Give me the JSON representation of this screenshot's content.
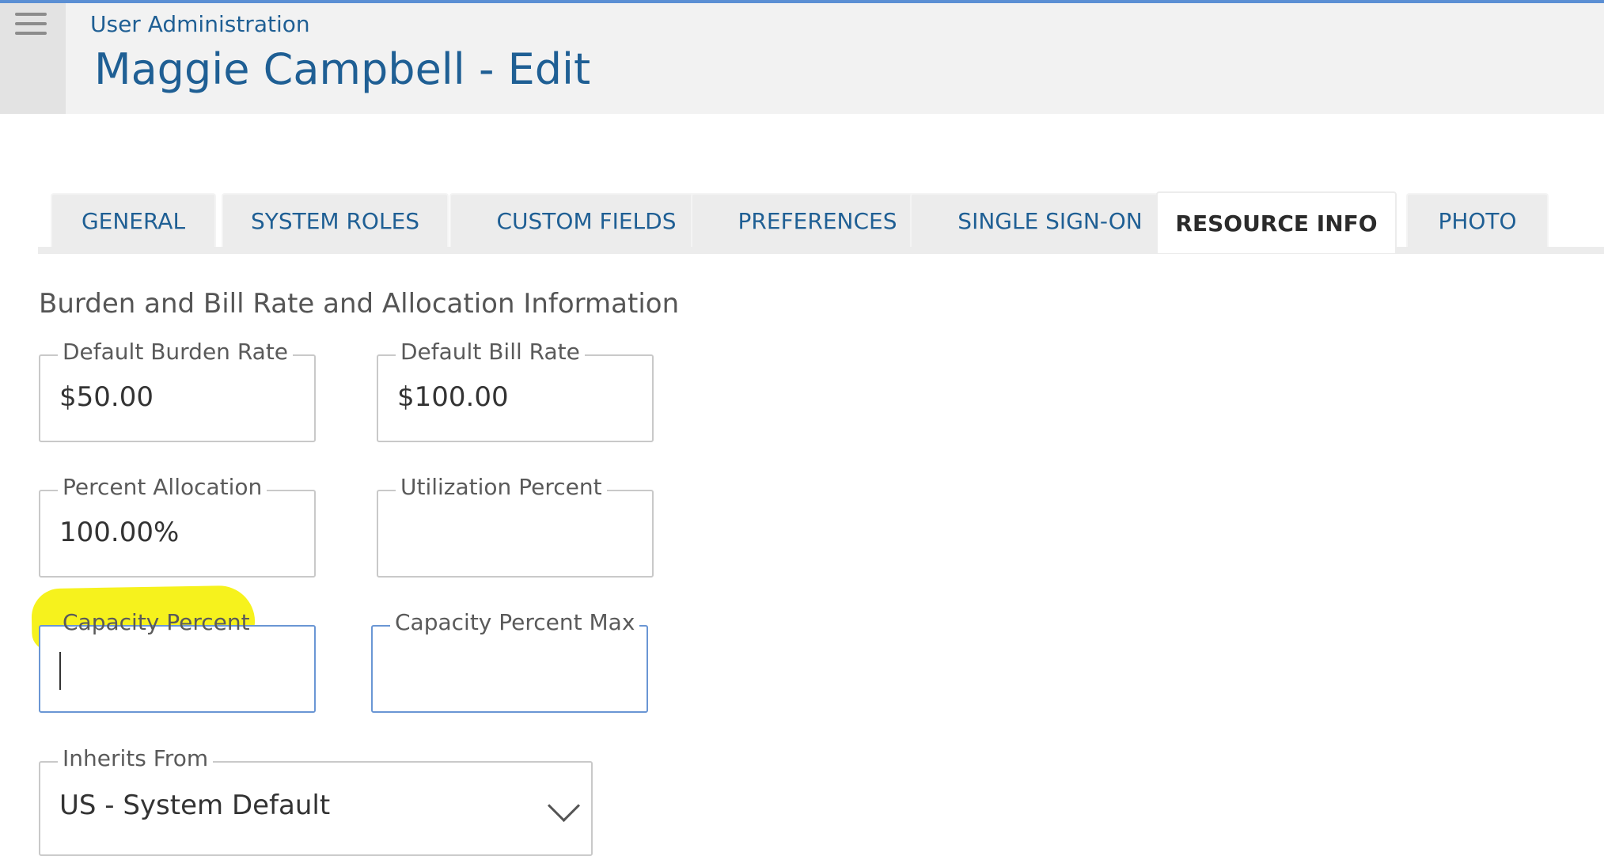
{
  "header": {
    "breadcrumb": "User Administration",
    "title": "Maggie Campbell - Edit",
    "menu_icon": "hamburger-menu-icon"
  },
  "tabs": [
    {
      "label": "GENERAL",
      "active": false
    },
    {
      "label": "SYSTEM ROLES",
      "active": false
    },
    {
      "label": "CUSTOM FIELDS",
      "active": false
    },
    {
      "label": "PREFERENCES",
      "active": false
    },
    {
      "label": "SINGLE SIGN-ON",
      "active": false
    },
    {
      "label": "RESOURCE INFO",
      "active": true
    },
    {
      "label": "PHOTO",
      "active": false
    }
  ],
  "section": {
    "title": "Burden and Bill Rate and Allocation Information"
  },
  "fields": {
    "default_burden_rate": {
      "label": "Default Burden Rate",
      "value": "$50.00"
    },
    "default_bill_rate": {
      "label": "Default Bill Rate",
      "value": "$100.00"
    },
    "percent_allocation": {
      "label": "Percent Allocation",
      "value": "100.00%"
    },
    "utilization_percent": {
      "label": "Utilization Percent",
      "value": ""
    },
    "capacity_percent": {
      "label": "Capacity Percent",
      "value": ""
    },
    "capacity_percent_max": {
      "label": "Capacity Percent Max",
      "value": ""
    },
    "inherits_from": {
      "label": "Inherits From",
      "value": "US - System Default"
    }
  },
  "colors": {
    "accent": "#1f5f94",
    "highlight": "#f6f21d",
    "focus_border": "#6a96d4"
  }
}
